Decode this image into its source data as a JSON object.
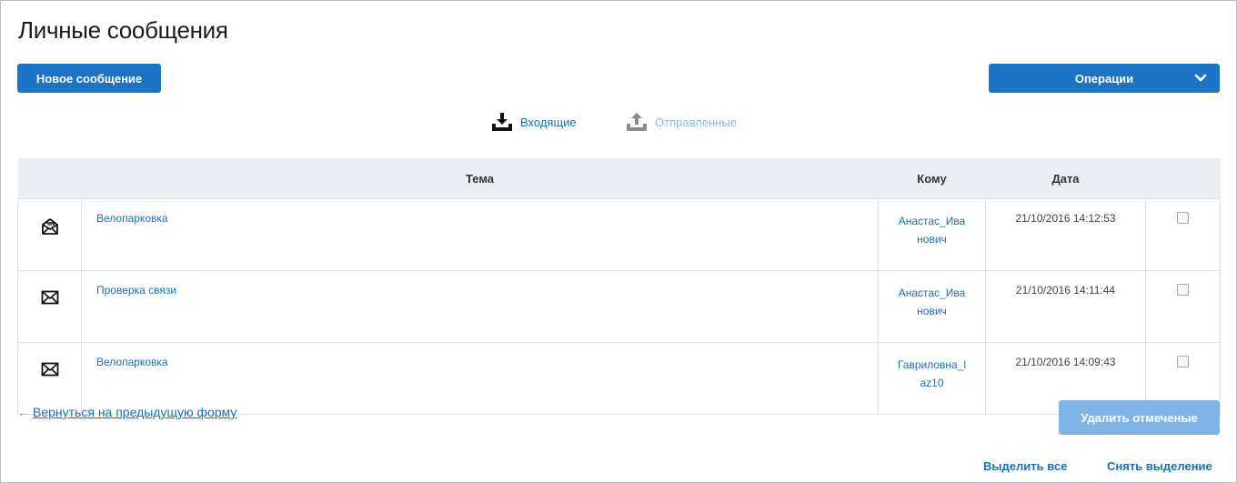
{
  "page": {
    "title": "Личные сообщения"
  },
  "toolbar": {
    "new_message_label": "Новое сообщение",
    "operations_label": "Операции"
  },
  "folders": {
    "inbox_label": "Входящие",
    "sent_label": "Отправленные"
  },
  "table": {
    "headers": {
      "subject": "Тема",
      "to": "Кому",
      "date": "Дата"
    },
    "rows": [
      {
        "icon": "open-envelope-icon",
        "subject": "Велопарковка",
        "to": "Анастас_Иванович",
        "date": "21/10/2016 14:12:53",
        "checked": false
      },
      {
        "icon": "envelope-icon",
        "subject": "Проверка связи",
        "to": "Анастас_Иванович",
        "date": "21/10/2016 14:11:44",
        "checked": false
      },
      {
        "icon": "envelope-icon",
        "subject": "Велопарковка",
        "to": "Гавриловна_laz10",
        "date": "21/10/2016 14:09:43",
        "checked": false
      }
    ]
  },
  "footer": {
    "back_arrow": "←",
    "back_label": "Вернуться на предыдущую форму",
    "delete_label": "Удалить отмеченые",
    "select_all_label": "Выделить все",
    "deselect_label": "Снять выделение"
  },
  "colors": {
    "primary": "#1a75c9",
    "primary_disabled": "#7fb4e6",
    "link": "#1a6fc0",
    "header_bg": "#eaeef3"
  }
}
